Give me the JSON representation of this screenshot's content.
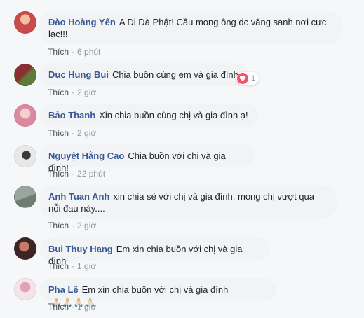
{
  "top_partial": "Thích · 6 phút",
  "comments": [
    {
      "author": "Đào Hoàng Yến",
      "text": "A Di Đà Phật! Cầu mong ông dc vãng sanh nơi cực lạc!!!",
      "like_label": "Thích",
      "time": "6 phút",
      "avatar_colors": [
        "#c94b4b",
        "#f0c0a0"
      ]
    },
    {
      "author": "Duc Hung Bui",
      "text": "Chia buồn cùng em và gia đình",
      "like_label": "Thích",
      "time": "2 giờ",
      "reaction_count": "1",
      "reaction_icon": "heart-icon",
      "avatar_colors": [
        "#8a3030",
        "#5f7a3a"
      ]
    },
    {
      "author": "Bảo Thanh",
      "text": "Xin chia buồn cùng chị và gia đình ạ!",
      "like_label": "Thích",
      "time": "2 giờ",
      "avatar_colors": [
        "#d98aa0",
        "#f3d0c8"
      ]
    },
    {
      "author": "Nguyệt Hằng Cao",
      "text": "Chia buồn với chị và gia đình!",
      "like_label": "Thích",
      "time": "22 phút",
      "avatar_colors": [
        "#e8e8e8",
        "#3a3a3a"
      ]
    },
    {
      "author": "Anh Tuan Anh",
      "text": "xin chia sẻ với chị và gia đình, mong chị vượt qua nỗi đau này....",
      "like_label": "Thích",
      "time": "2 giờ",
      "avatar_colors": [
        "#9aa5a0",
        "#6e7d72"
      ]
    },
    {
      "author": "Bui Thuy Hang",
      "text": "Em xin chia buồn với chị và gia đình",
      "like_label": "Thích",
      "time": "1 giờ",
      "avatar_colors": [
        "#3d2525",
        "#c57b6a"
      ]
    },
    {
      "author": "Pha Lê",
      "text": "Em xin chia buồn với chị và gia đình",
      "like_label": "Thích",
      "time": "1 giờ",
      "emoji": "🙏🏻🙏🏻🙏🏻🙏🏻",
      "emoji_icon": "praying-hands-icon",
      "avatar_colors": [
        "#f4e4e8",
        "#e0a0b5"
      ]
    }
  ],
  "colors": {
    "author": "#385898",
    "bubble": "#f2f3f5",
    "meta": "#90949c",
    "background": "#f6f7f9",
    "heart": "#f25268"
  }
}
